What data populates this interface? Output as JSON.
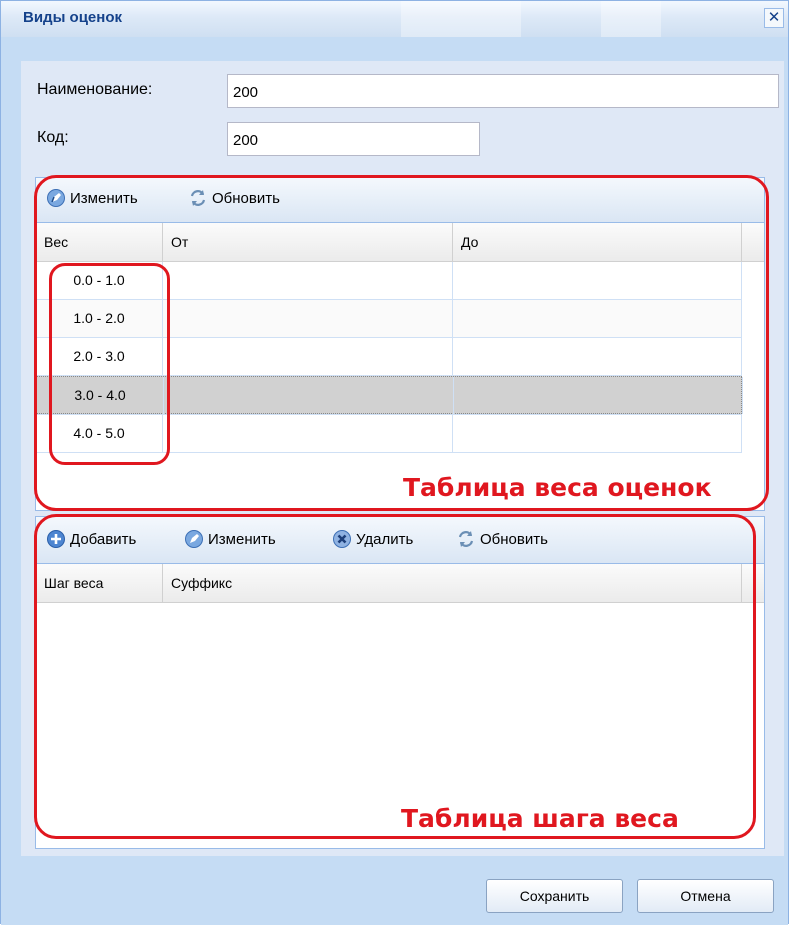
{
  "window": {
    "title": "Виды оценок"
  },
  "form": {
    "name_label": "Наименование:",
    "name_value": "200",
    "code_label": "Код:",
    "code_value": "200"
  },
  "weight_panel": {
    "toolbar": {
      "edit": "Изменить",
      "refresh": "Обновить"
    },
    "columns": [
      "Вес",
      "От",
      "До"
    ],
    "rows": [
      {
        "weight": "0.0 - 1.0",
        "from": "",
        "to": ""
      },
      {
        "weight": "1.0 - 2.0",
        "from": "",
        "to": ""
      },
      {
        "weight": "2.0 - 3.0",
        "from": "",
        "to": ""
      },
      {
        "weight": "3.0 - 4.0",
        "from": "",
        "to": ""
      },
      {
        "weight": "4.0 - 5.0",
        "from": "",
        "to": ""
      }
    ],
    "annotation": "Таблица веса оценок"
  },
  "step_panel": {
    "toolbar": {
      "add": "Добавить",
      "edit": "Изменить",
      "delete": "Удалить",
      "refresh": "Обновить"
    },
    "columns": [
      "Шаг веса",
      "Суффикс"
    ],
    "annotation": "Таблица шага веса"
  },
  "buttons": {
    "save": "Сохранить",
    "cancel": "Отмена"
  },
  "colors": {
    "annotation_red": "#e0171f",
    "selected_row": "#d1d1d1",
    "title_text": "#15428b"
  }
}
